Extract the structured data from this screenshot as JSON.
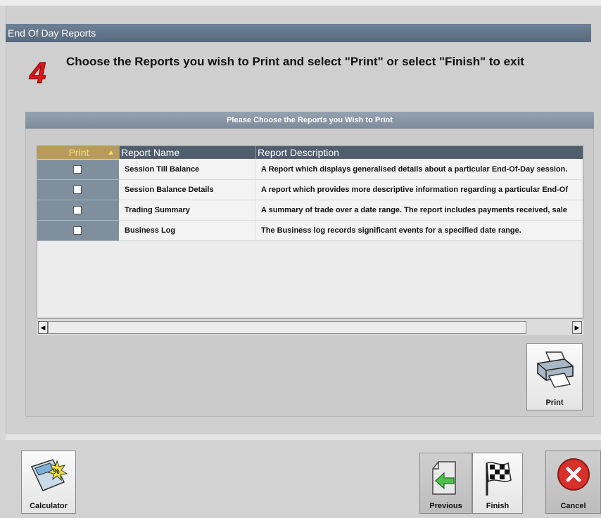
{
  "window": {
    "title": "End Of Day Reports"
  },
  "step": {
    "number": "4",
    "instruction": "Choose the Reports you wish to Print and select \"Print\" or select \"Finish\" to exit"
  },
  "panel": {
    "header": "Please Choose the Reports you Wish to Print"
  },
  "table": {
    "columns": {
      "print": "Print",
      "name": "Report Name",
      "description": "Report Description"
    },
    "rows": [
      {
        "checked": false,
        "name": "Session Till Balance",
        "description": "A Report which displays generalised details about a particular End-Of-Day session."
      },
      {
        "checked": false,
        "name": "Session Balance Details",
        "description": "A report which provides more descriptive information regarding a particular End-Of"
      },
      {
        "checked": false,
        "name": "Trading Summary",
        "description": "A summary of trade over a date range. The report includes payments received, sale"
      },
      {
        "checked": false,
        "name": "Business Log",
        "description": "The Business log records significant events for a specified date range."
      }
    ]
  },
  "buttons": {
    "print": "Print",
    "calculator": "Calculator",
    "previous": "Previous",
    "finish": "Finish",
    "cancel": "Cancel"
  },
  "colors": {
    "title_bar": "#5f7286",
    "step_number": "#e8141c",
    "print_column_header": "#b89a5a",
    "cancel_icon": "#d9302b"
  }
}
